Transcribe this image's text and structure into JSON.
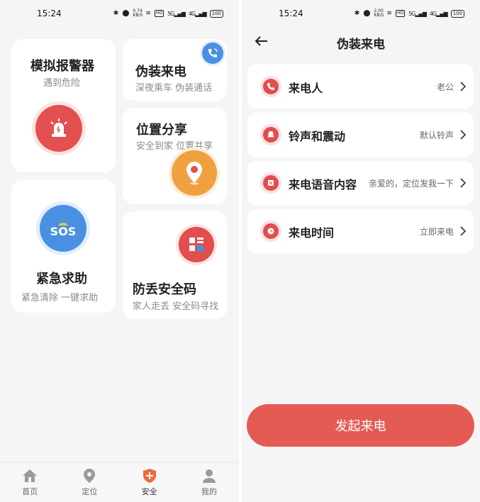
{
  "left": {
    "status_time": "15:24",
    "net_speed_value": "0.74",
    "net_speed_unit": "KB/S",
    "hd_label": "HD",
    "signal_label_1": "5G",
    "signal_label_2": "4G",
    "battery": "100",
    "cards": {
      "alarm": {
        "title": "模拟报警器",
        "subtitle": "遇到危险"
      },
      "fake_call": {
        "title": "伪装来电",
        "subtitle": "深夜乘车  伪装通话"
      },
      "location": {
        "title": "位置分享",
        "subtitle": "安全到家  位置共享"
      },
      "sos": {
        "title": "紧急求助",
        "subtitle": "紧急清除  一键求助",
        "badge": "SOS"
      },
      "anti_lost": {
        "title": "防丢安全码",
        "subtitle": "家人走丢  安全码寻找"
      }
    },
    "tabs": [
      {
        "label": "首页",
        "icon": "home-icon"
      },
      {
        "label": "定位",
        "icon": "location-icon"
      },
      {
        "label": "安全",
        "icon": "shield-plus-icon"
      },
      {
        "label": "我的",
        "icon": "user-icon"
      }
    ],
    "colors": {
      "alarm": "#e2504f",
      "sos": "#4a90e2",
      "location": "#f0a040",
      "anti_lost": "#e24d4d",
      "active_tab": "#f06b3c"
    }
  },
  "right": {
    "status_time": "15:24",
    "net_speed_value": "2.00",
    "net_speed_unit": "KB/S",
    "hd_label": "HD",
    "signal_label_1": "5G",
    "signal_label_2": "4G",
    "battery": "100",
    "title": "伪装来电",
    "rows": [
      {
        "label": "来电人",
        "value": "老公",
        "icon": "phone-icon"
      },
      {
        "label": "铃声和震动",
        "value": "默认铃声",
        "icon": "bell-icon"
      },
      {
        "label": "来电语音内容",
        "value": "亲爱的，定位发我一下",
        "icon": "message-icon"
      },
      {
        "label": "来电时间",
        "value": "立即来电",
        "icon": "clock-icon"
      }
    ],
    "start_button": "发起来电",
    "colors": {
      "accent": "#e45b54"
    }
  }
}
